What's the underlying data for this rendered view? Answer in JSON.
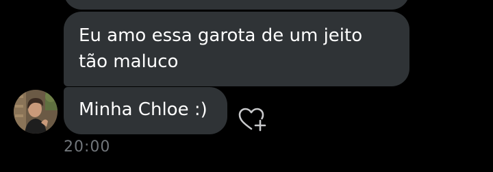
{
  "messages": [
    {
      "text": "Eu amo essa garota de um jeito tão maluco"
    },
    {
      "text": "Minha Chloe :)"
    }
  ],
  "timestamp": "20:00",
  "icons": {
    "like": "heart-plus-icon",
    "avatar": "user-avatar"
  },
  "colors": {
    "background": "#000000",
    "bubble": "#2f3336",
    "text": "#ffffff",
    "muted": "#71767b"
  }
}
